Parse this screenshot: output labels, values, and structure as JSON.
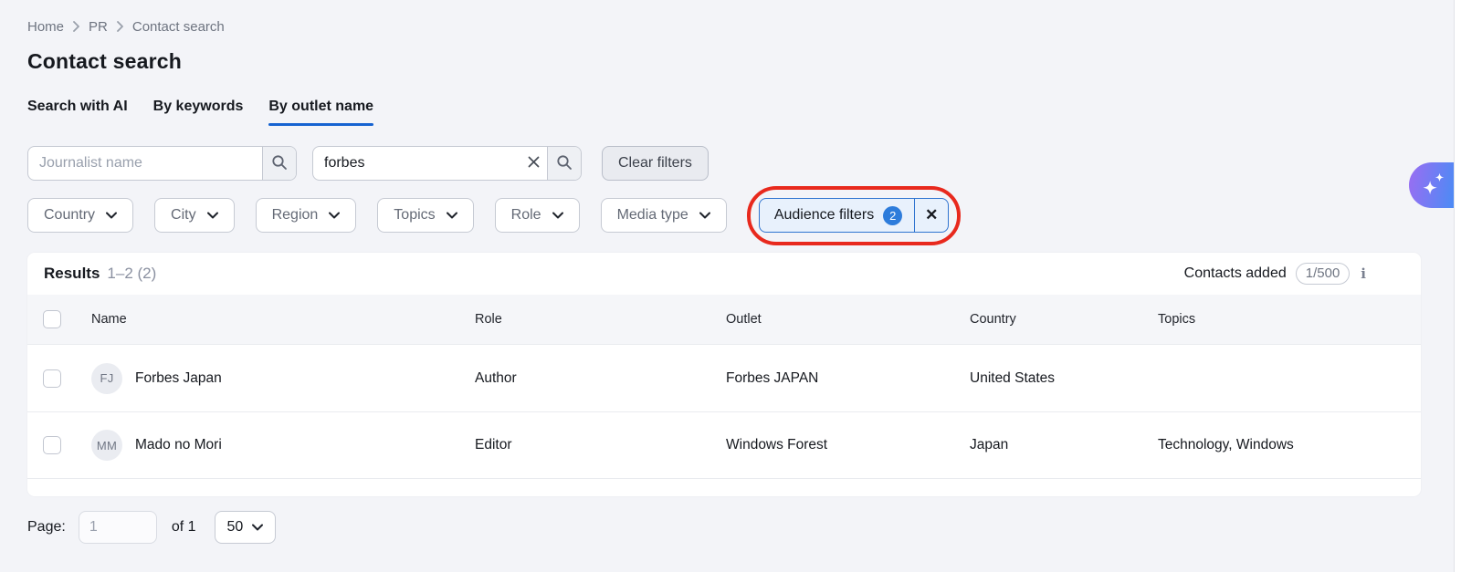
{
  "breadcrumb": {
    "items": [
      "Home",
      "PR",
      "Contact search"
    ]
  },
  "page": {
    "title": "Contact search"
  },
  "tabs": [
    {
      "label": "Search with AI",
      "active": false
    },
    {
      "label": "By keywords",
      "active": false
    },
    {
      "label": "By outlet name",
      "active": true
    }
  ],
  "search": {
    "journalist": {
      "placeholder": "Journalist name",
      "value": ""
    },
    "outlet": {
      "value": "forbes"
    },
    "clear_filters_label": "Clear filters"
  },
  "filters": {
    "dropdowns": [
      "Country",
      "City",
      "Region",
      "Topics",
      "Role",
      "Media type"
    ],
    "audience": {
      "label": "Audience filters",
      "count": "2"
    }
  },
  "results": {
    "title": "Results",
    "range": "1–2 (2)",
    "contacts_added_label": "Contacts added",
    "contacts_added_count": "1/500"
  },
  "table": {
    "columns": [
      "Name",
      "Role",
      "Outlet",
      "Country",
      "Topics"
    ],
    "rows": [
      {
        "initials": "FJ",
        "name": "Forbes Japan",
        "role": "Author",
        "outlet": "Forbes JAPAN",
        "country": "United States",
        "topics": ""
      },
      {
        "initials": "MM",
        "name": "Mado no Mori",
        "role": "Editor",
        "outlet": "Windows Forest",
        "country": "Japan",
        "topics": "Technology, Windows"
      }
    ]
  },
  "pagination": {
    "page_label": "Page:",
    "page_value": "1",
    "of_label": "of 1",
    "page_size": "50"
  },
  "icons": {
    "close": "✕",
    "info": "i"
  },
  "colors": {
    "background": "#f3f4f8",
    "accent_blue": "#1663d1",
    "audience_bg": "#e8f1fc",
    "audience_border": "#2f74d0",
    "badge_blue": "#2d7cdb",
    "annotation_red": "#e8291d",
    "ai_gradient_start": "#9b6df2",
    "ai_gradient_end": "#4b8bf5"
  }
}
